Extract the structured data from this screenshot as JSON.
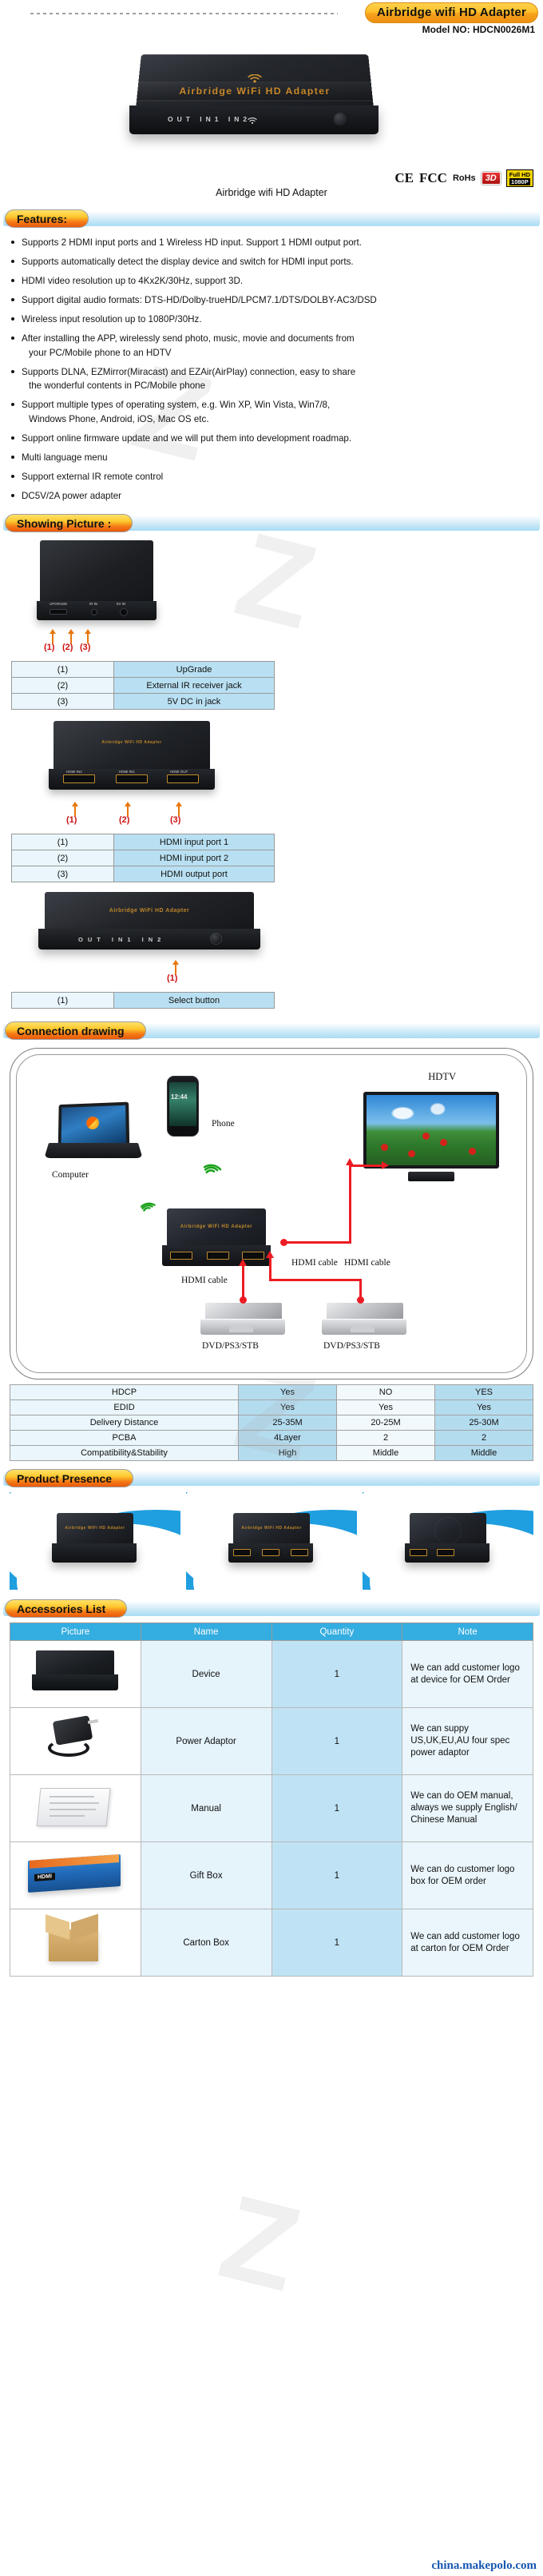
{
  "header": {
    "title_badge": "Airbridge wifi HD Adapter",
    "model_label": "Model NO: HDCN0026M1"
  },
  "hero": {
    "device_brand": "Airbridge  WiFi  HD Adapter",
    "front_labels": "OUT   IN1   IN2",
    "caption": "Airbridge wifi HD Adapter",
    "certs": {
      "ce": "CE",
      "fc": "FCC",
      "rohs": "RoHs",
      "three_d": "3D",
      "full_hd_line1": "Full HD",
      "full_hd_line2": "1080P"
    }
  },
  "sections": {
    "features": "Features:",
    "showing_picture": "Showing Picture :",
    "connection_drawing": "Connection drawing",
    "product_presence": "Product Presence",
    "accessories_list": "Accessories List"
  },
  "features": [
    "Supports 2 HDMI input ports and 1 Wireless HD input. Support 1 HDMI output port.",
    "Supports automatically detect the display device and switch for HDMI input ports.",
    "HDMI video resolution up to 4Kx2K/30Hz, support 3D.",
    "Support digital audio formats: DTS-HD/Dolby-trueHD/LPCM7.1/DTS/DOLBY-AC3/DSD",
    "Wireless input resolution up to 1080P/30Hz.",
    "After installing the APP, wirelessly send photo, music, movie and documents from",
    "Supports DLNA, EZMirror(Miracast) and EZAir(AirPlay) connection, easy to share",
    "Support multiple types of operating system, e.g. Win XP, Win Vista, Win7/8,",
    "Support online firmware update and we will put them into development roadmap.",
    "Multi language menu",
    "Support external IR remote control",
    "DC5V/2A power adapter"
  ],
  "feature_continuations": {
    "after_5": "your PC/Mobile phone to an HDTV",
    "after_6": "the wonderful contents in PC/Mobile phone",
    "after_7": "Windows Phone, Android, iOS, Mac OS etc."
  },
  "port_tables": {
    "rear": {
      "callouts": [
        "(1)",
        "(2)",
        "(3)"
      ],
      "rows": [
        {
          "key": "(1)",
          "value": "UpGrade"
        },
        {
          "key": "(2)",
          "value": "External IR receiver jack"
        },
        {
          "key": "(3)",
          "value": "5V DC in jack"
        }
      ],
      "port_captions": [
        "UPGRADE",
        "IR IN",
        "5V IN"
      ]
    },
    "hdmi": {
      "callouts": [
        "(1)",
        "(2)",
        "(3)"
      ],
      "rows": [
        {
          "key": "(1)",
          "value": "HDMI input port 1"
        },
        {
          "key": "(2)",
          "value": "HDMI input port 2"
        },
        {
          "key": "(3)",
          "value": "HDMI output port"
        }
      ],
      "port_captions": [
        "HDMI IN2",
        "HDMI IN1",
        "HDMI OUT"
      ]
    },
    "front": {
      "callouts": [
        "(1)"
      ],
      "rows": [
        {
          "key": "(1)",
          "value": "Select button"
        }
      ],
      "front_labels": "OUT   IN1   IN2"
    }
  },
  "connection": {
    "labels": {
      "computer": "Computer",
      "phone": "Phone",
      "hdtv": "HDTV",
      "hdmi_cable_tv": "HDMI cable",
      "hdmi_cable_left": "HDMI cable",
      "hdmi_cable_right": "HDMI cable",
      "source_left": "DVD/PS3/STB",
      "source_right": "DVD/PS3/STB"
    },
    "hub_brand": "Airbridge WiFi HD Adapter"
  },
  "comparison_table": {
    "rows": [
      {
        "label": "HDCP",
        "values": [
          "Yes",
          "NO",
          "YES"
        ]
      },
      {
        "label": "EDID",
        "values": [
          "Yes",
          "Yes",
          "Yes"
        ]
      },
      {
        "label": "Delivery  Distance",
        "values": [
          "25-35M",
          "20-25M",
          "25-30M"
        ]
      },
      {
        "label": "PCBA",
        "values": [
          "4Layer",
          "2",
          "2"
        ]
      },
      {
        "label": "Compatibility&Stability",
        "values": [
          "High",
          "Middle",
          "Middle"
        ]
      }
    ]
  },
  "accessories": {
    "columns": [
      "Picture",
      "Name",
      "Quantity",
      "Note"
    ],
    "rows": [
      {
        "picture": "device-thumbnail",
        "name": "Device",
        "quantity": "1",
        "note": "We can add customer logo at device for OEM Order"
      },
      {
        "picture": "power-adaptor-thumbnail",
        "name": "Power Adaptor",
        "quantity": "1",
        "note": "We can suppy US,UK,EU,AU four spec power adaptor"
      },
      {
        "picture": "manual-thumbnail",
        "name": "Manual",
        "quantity": "1",
        "note": "We can do OEM manual, always we supply English/ Chinese Manual"
      },
      {
        "picture": "gift-box-thumbnail",
        "name": "Gift Box",
        "quantity": "1",
        "note": "We can do customer logo box for OEM order"
      },
      {
        "picture": "carton-box-thumbnail",
        "name": "Carton Box",
        "quantity": "1",
        "note": "We can add customer logo at carton for OEM Order"
      }
    ]
  },
  "gift_box_tag": "HDMI",
  "watermark": "china.makepolo.com",
  "colors": {
    "pill_orange": "#f47a16",
    "bar_blue": "#a9dcf4",
    "table_blue_dark": "#b4dcef",
    "table_blue_light": "#eaf6fc",
    "acc_header": "#34ade0",
    "red_cable": "#ec1c24",
    "brand_gold": "#c98a2e"
  }
}
